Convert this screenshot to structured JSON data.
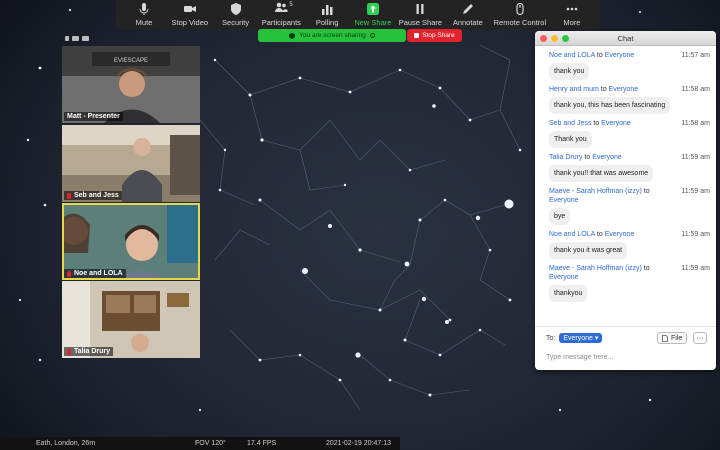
{
  "toolbar": {
    "items": [
      {
        "label": "Mute",
        "icon": "microphone-icon"
      },
      {
        "label": "Stop Video",
        "icon": "video-camera-icon"
      },
      {
        "label": "Security",
        "icon": "shield-icon"
      },
      {
        "label": "Participants",
        "icon": "participants-icon",
        "count": "5"
      },
      {
        "label": "Polling",
        "icon": "bar-chart-icon"
      },
      {
        "label": "New Share",
        "icon": "share-arrow-icon",
        "highlight": true
      },
      {
        "label": "Pause Share",
        "icon": "pause-icon"
      },
      {
        "label": "Annotate",
        "icon": "pen-icon"
      },
      {
        "label": "Remote Control",
        "icon": "mouse-icon"
      },
      {
        "label": "More",
        "icon": "ellipsis-icon"
      }
    ]
  },
  "share_banner": {
    "text": "You are screen sharing",
    "stop_label": "Stop Share"
  },
  "participants": [
    {
      "name": "Matt - Presenter",
      "muted": false
    },
    {
      "name": "Seb and Jess",
      "muted": true
    },
    {
      "name": "Noe and LOLA",
      "muted": true,
      "active": true
    },
    {
      "name": "Talia Drury",
      "muted": true
    }
  ],
  "status_bar": {
    "location": "Eath, London, 26m",
    "fov": "FOV 120°",
    "fps": "17.4 FPS",
    "datetime": "2021-02-19   20:47:13"
  },
  "chat": {
    "title": "Chat",
    "messages": [
      {
        "from": "Noe and LOLA",
        "to": "Everyone",
        "time": "11:57 am",
        "text": "thank you"
      },
      {
        "from": "Henry and mum",
        "to": "Everyone",
        "time": "11:58 am",
        "text": "thank you, this has been fascinating"
      },
      {
        "from": "Seb and Jess",
        "to": "Everyone",
        "time": "11:58 am",
        "text": "Thank you"
      },
      {
        "from": "Talia Drury",
        "to": "Everyone",
        "time": "11:59 am",
        "text": "thank you!! that was awesome"
      },
      {
        "from": "Maeve - Sarah Hoffman (izzy)",
        "to": "Everyone",
        "time": "11:59 am",
        "text": "bye"
      },
      {
        "from": "Noe and LOLA",
        "to": "Everyone",
        "time": "11:59 am",
        "text": "thank you it was great"
      },
      {
        "from": "Maeve - Sarah Hoffman (izzy)",
        "to": "Everyone",
        "time": "11:59 am",
        "text": "thankyou"
      }
    ],
    "to_label": "To:",
    "audience": "Everyone",
    "file_label": "File",
    "more_label": "···",
    "input_placeholder": "Type message here..."
  },
  "colors": {
    "accent": "#2d6bd6",
    "share_green": "#26c23b",
    "stop_red": "#e0232d",
    "toolbar_bg": "#232323"
  }
}
